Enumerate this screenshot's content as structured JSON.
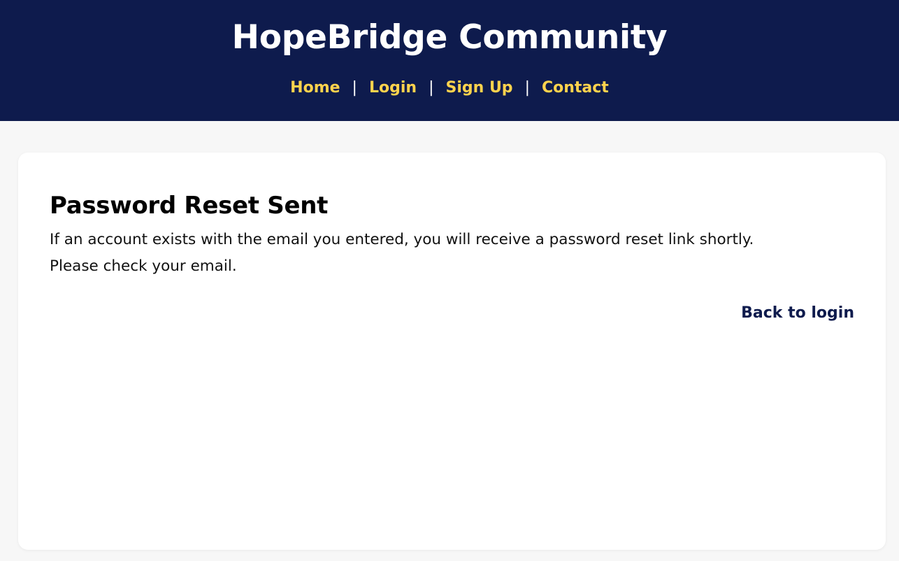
{
  "header": {
    "title": "HopeBridge Community",
    "nav": {
      "home": "Home",
      "login": "Login",
      "signup": "Sign Up",
      "contact": "Contact",
      "separator": "|"
    }
  },
  "card": {
    "title": "Password Reset Sent",
    "line1": "If an account exists with the email you entered, you will receive a password reset link shortly.",
    "line2": "Please check your email.",
    "back_link": "Back to login"
  },
  "colors": {
    "header_bg": "#0e1b4d",
    "nav_link": "#ffd34d",
    "page_bg": "#f7f7f7",
    "card_bg": "#ffffff"
  }
}
